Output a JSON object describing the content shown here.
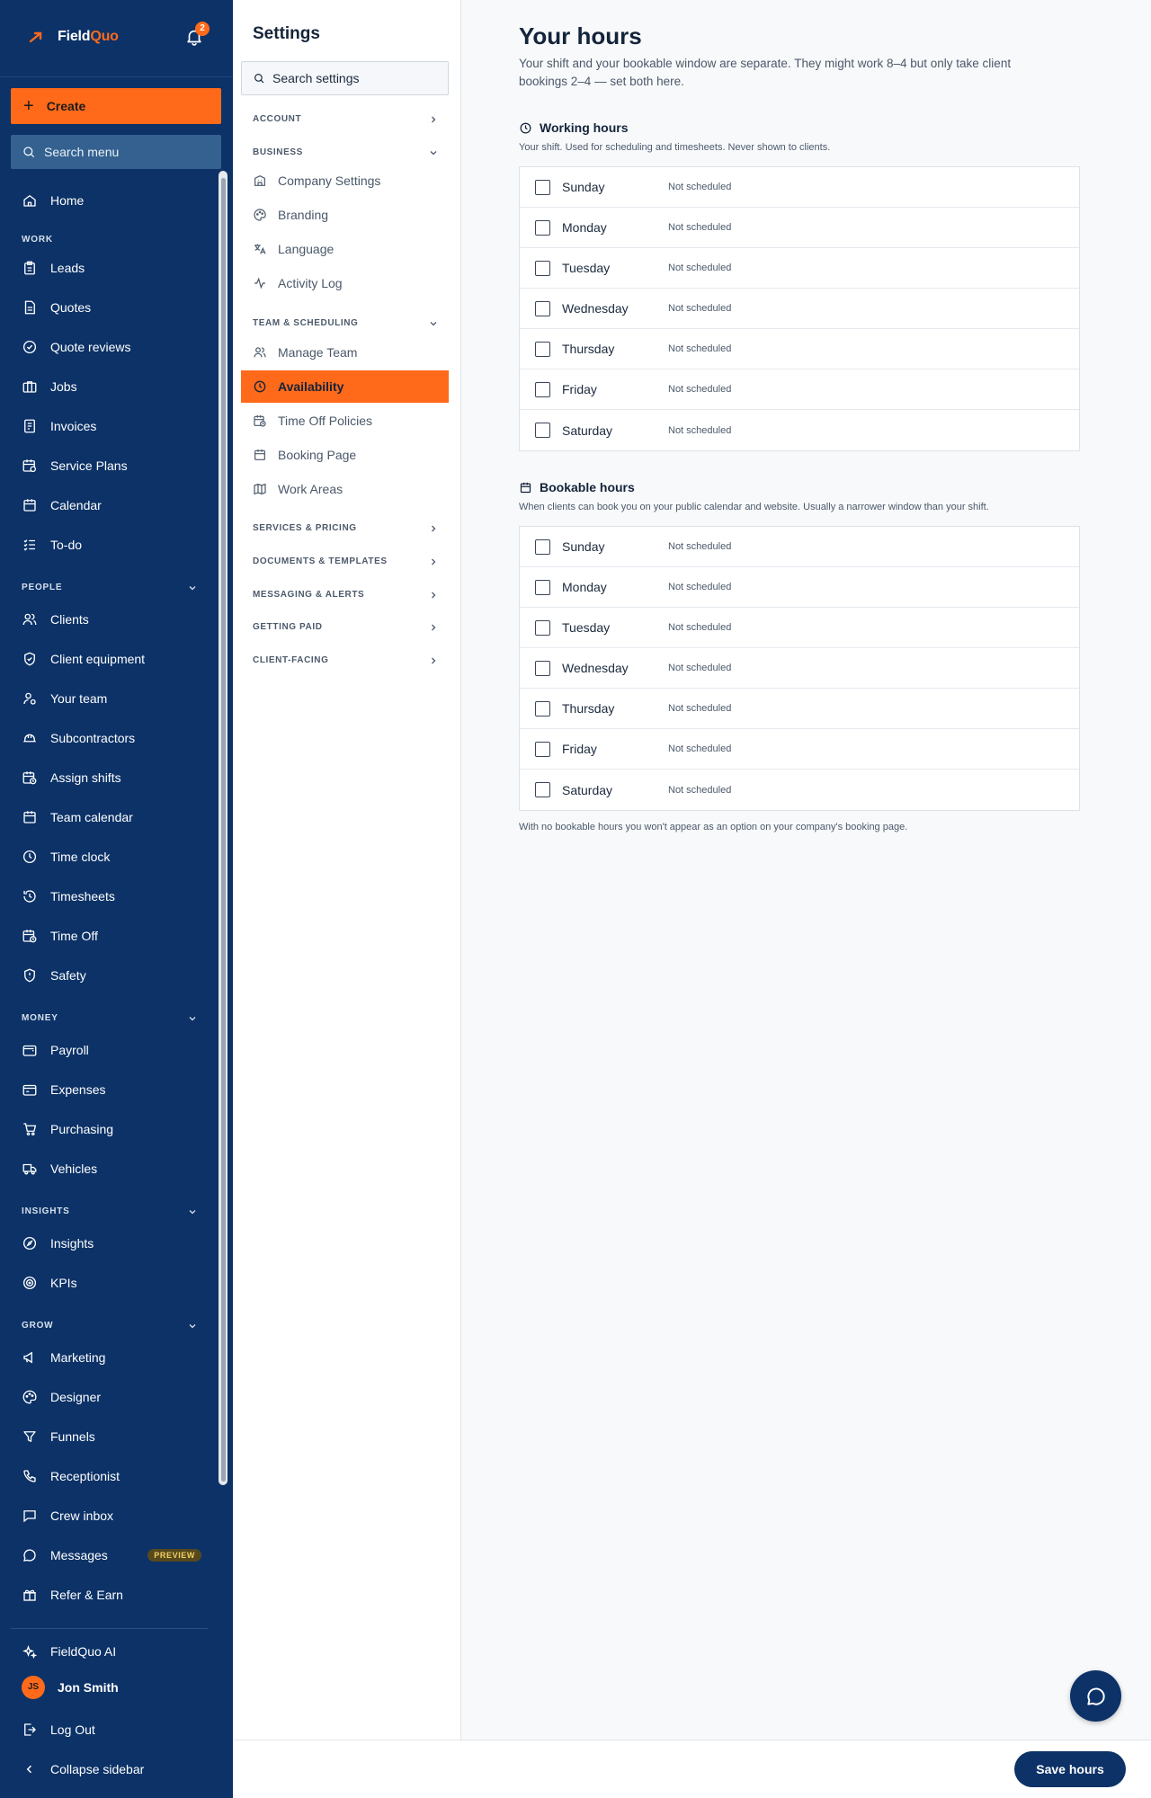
{
  "app": {
    "brand_prefix": "Field",
    "brand_suffix": "Quo",
    "notification_count": "2"
  },
  "sidebar": {
    "create_label": "Create",
    "search_placeholder": "Search menu",
    "home_label": "Home",
    "sections": {
      "work": "WORK",
      "people": "PEOPLE",
      "money": "MONEY",
      "insights": "INSIGHTS",
      "grow": "GROW"
    },
    "work_items": [
      "Leads",
      "Quotes",
      "Quote reviews",
      "Jobs",
      "Invoices",
      "Service Plans",
      "Calendar",
      "To-do"
    ],
    "people_items": [
      "Clients",
      "Client equipment",
      "Your team",
      "Subcontractors",
      "Assign shifts",
      "Team calendar",
      "Time clock",
      "Timesheets",
      "Time Off",
      "Safety"
    ],
    "money_items": [
      "Payroll",
      "Expenses",
      "Purchasing",
      "Vehicles"
    ],
    "insights_items": [
      "Insights",
      "KPIs"
    ],
    "grow_items": [
      "Marketing",
      "Designer",
      "Funnels",
      "Receptionist",
      "Crew inbox",
      "Messages",
      "Refer & Earn"
    ],
    "messages_badge": "PREVIEW",
    "ai_label": "FieldQuo AI",
    "user": {
      "initials": "JS",
      "name": "Jon Smith"
    },
    "logout_label": "Log Out",
    "collapse_label": "Collapse sidebar"
  },
  "settings": {
    "title": "Settings",
    "search_placeholder": "Search settings",
    "groups": {
      "account": "ACCOUNT",
      "business": "BUSINESS",
      "team_scheduling": "TEAM & SCHEDULING",
      "services_pricing": "SERVICES & PRICING",
      "documents_templates": "DOCUMENTS & TEMPLATES",
      "messaging_alerts": "MESSAGING & ALERTS",
      "getting_paid": "GETTING PAID",
      "client_facing": "CLIENT-FACING"
    },
    "business_items": [
      "Company Settings",
      "Branding",
      "Language",
      "Activity Log"
    ],
    "team_items": [
      "Manage Team",
      "Availability",
      "Time Off Policies",
      "Booking Page",
      "Work Areas"
    ],
    "active_item": "Availability"
  },
  "main": {
    "title": "Your hours",
    "description": "Your shift and your bookable window are separate. They might work 8–4 but only take client bookings 2–4 — set both here.",
    "working": {
      "title": "Working hours",
      "description": "Your shift. Used for scheduling and timesheets. Never shown to clients.",
      "days": [
        {
          "day": "Sunday",
          "status": "Not scheduled"
        },
        {
          "day": "Monday",
          "status": "Not scheduled"
        },
        {
          "day": "Tuesday",
          "status": "Not scheduled"
        },
        {
          "day": "Wednesday",
          "status": "Not scheduled"
        },
        {
          "day": "Thursday",
          "status": "Not scheduled"
        },
        {
          "day": "Friday",
          "status": "Not scheduled"
        },
        {
          "day": "Saturday",
          "status": "Not scheduled"
        }
      ]
    },
    "bookable": {
      "title": "Bookable hours",
      "description": "When clients can book you on your public calendar and website. Usually a narrower window than your shift.",
      "days": [
        {
          "day": "Sunday",
          "status": "Not scheduled"
        },
        {
          "day": "Monday",
          "status": "Not scheduled"
        },
        {
          "day": "Tuesday",
          "status": "Not scheduled"
        },
        {
          "day": "Wednesday",
          "status": "Not scheduled"
        },
        {
          "day": "Thursday",
          "status": "Not scheduled"
        },
        {
          "day": "Friday",
          "status": "Not scheduled"
        },
        {
          "day": "Saturday",
          "status": "Not scheduled"
        }
      ]
    },
    "footnote": "With no bookable hours you won't appear as an option on your company's booking page.",
    "save_label": "Save hours"
  },
  "colors": {
    "sidebar_bg": "#0c3267",
    "accent": "#ff6a1a",
    "search_bg": "#34618f"
  }
}
